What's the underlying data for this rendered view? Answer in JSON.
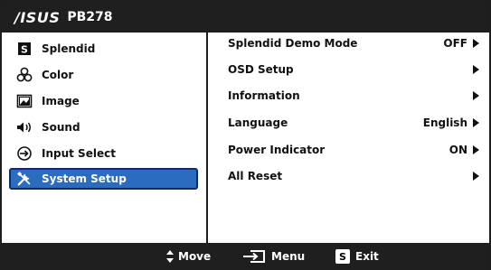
{
  "header": {
    "brand": "/ISUS",
    "model": "PB278"
  },
  "sidebar": {
    "items": [
      {
        "label": "Splendid",
        "icon": "splendid-s-icon"
      },
      {
        "label": "Color",
        "icon": "color-circles-icon"
      },
      {
        "label": "Image",
        "icon": "image-icon"
      },
      {
        "label": "Sound",
        "icon": "speaker-icon"
      },
      {
        "label": "Input Select",
        "icon": "input-select-icon"
      },
      {
        "label": "System Setup",
        "icon": "tools-icon",
        "selected": true
      }
    ]
  },
  "panel": {
    "rows": [
      {
        "label": "Splendid Demo Mode",
        "value": "OFF"
      },
      {
        "label": "OSD Setup",
        "value": ""
      },
      {
        "label": "Information",
        "value": ""
      },
      {
        "label": "Language",
        "value": "English"
      },
      {
        "label": "Power Indicator",
        "value": "ON"
      },
      {
        "label": "All Reset",
        "value": ""
      }
    ]
  },
  "footer": {
    "move_label": "Move",
    "menu_label": "Menu",
    "exit_label": "Exit",
    "exit_key": "S"
  },
  "colors": {
    "header_bg": "#1f1f1f",
    "selected_bg": "#2b6cbf",
    "text": "#111111"
  }
}
